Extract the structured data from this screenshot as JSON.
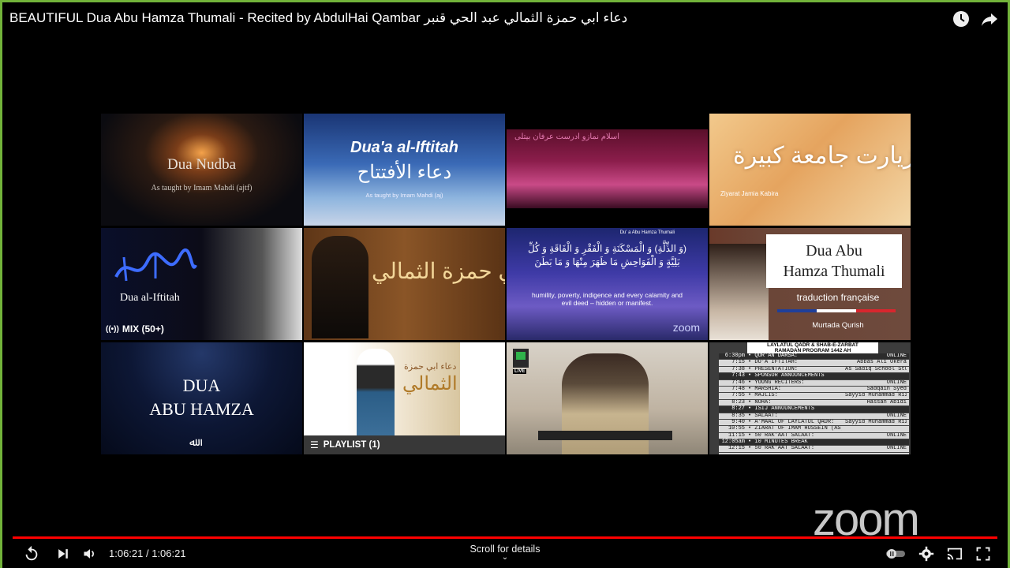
{
  "window": {
    "title": "BEAUTIFUL Dua Abu Hamza Thumali - Recited by AbdulHai Qambar دعاء ابي حمزة الثمالي عبد الحي قنبر"
  },
  "tiles": [
    {
      "title": "Dua Nudba",
      "subtitle": "As taught by Imam Mahdi (ajtf)"
    },
    {
      "title": "Dua'a al-Iftitah",
      "arabic": "دعاء الأفتتاح",
      "subtitle": "As taught by Imam Mahdi (aj)"
    },
    {
      "arabic": "اسلام نمازو ادرست عرفان بیتلی"
    },
    {
      "arabic": "زیارت جامعة کبیرة",
      "subtitle": "Ziyarat Jamia Kabira"
    },
    {
      "title": "Dua al-Iftitah",
      "badge": "MIX (50+)"
    },
    {
      "arabic": "دعاء أبي حمزة الثمالي"
    },
    {
      "header": "Du' a Abu Hamza Thumali",
      "arabic": "(وَ الذِّلَّةِ) وَ الْمَسْكَنَةِ وَ الْفَقْرِ وَ الْفَاقَةِ وَ كُلِّ بَلِيَّةٍ وَ الْفَوَاحِشِ مَا ظَهَرَ مِنْهَا وَ مَا بَطَنَ",
      "english": "humility, poverty, indigence and every calamity and evil deed – hidden or manifest.",
      "watermark": "zoom"
    },
    {
      "title_line1": "Dua Abu",
      "title_line2": "Hamza Thumali",
      "subtitle": "traduction française",
      "author": "Murtada Qurish"
    },
    {
      "title_line1": "DUA",
      "title_line2": "ABU HAMZA"
    },
    {
      "arabic_small": "دعاء ابي حمزة",
      "arabic_big": "الثمالي",
      "badge": "PLAYLIST (1)"
    },
    {
      "badge": "LIVE"
    },
    {
      "header1": "LAYLATUL QADR & SHAB-E-ZARBAT",
      "header2": "RAMADAN PROGRAM 1442 AH",
      "rows": [
        {
          "time": "6:30pm",
          "item": "• QUR'AN DARSA:",
          "who": "ONLINE",
          "dark": true
        },
        {
          "time": "7:15",
          "item": "• DU'A IFTITAH:",
          "who": "Abbas Ali Okera",
          "dark": false
        },
        {
          "time": "7:38",
          "item": "• PRESENTATION:",
          "who": "As Sadiq School Students",
          "dark": false
        },
        {
          "time": "7:43",
          "item": "• SPONSOR ANNOUNCEMENTS",
          "who": "",
          "dark": true
        },
        {
          "time": "7:46",
          "item": "• YOUNG RECITERS:",
          "who": "ONLINE",
          "dark": false
        },
        {
          "time": "7:48",
          "item": "• MARSHIA:",
          "who": "Sadqain Syed",
          "dark": false
        },
        {
          "time": "7:55",
          "item": "• MAJLIS:",
          "who": "Sayyid Muhammad Rizvi",
          "dark": false
        },
        {
          "time": "8:23",
          "item": "• NOHA:",
          "who": "Hassan Abidi",
          "dark": false
        },
        {
          "time": "8:27",
          "item": "• ISIJ ANNOUNCEMENTS",
          "who": "",
          "dark": true
        },
        {
          "time": "8:35",
          "item": "• SALAAT:",
          "who": "ONLINE",
          "dark": false
        },
        {
          "time": "9:40",
          "item": "• A'MAAL OF LAYLATUL QADR:",
          "who": "Sayyid Muhammad Rizvi",
          "dark": false
        },
        {
          "time": "10:55",
          "item": "• ZIARAT OF IMAM HUSSEIN (AS) ON THE NIGHT OF QADR",
          "who": "",
          "dark": false
        },
        {
          "time": "11:15",
          "item": "• 50 RAK'AAT SALAAT:",
          "who": "ONLINE",
          "dark": false
        },
        {
          "time": "12:05am",
          "item": "• 10 MINUTES BREAK",
          "who": "",
          "dark": true
        },
        {
          "time": "12:15",
          "item": "• 50 RAK'AAT SALAAT:",
          "who": "ONLINE",
          "dark": false
        }
      ]
    }
  ],
  "watermark": {
    "text": "zoom"
  },
  "player": {
    "time_current": "1:06:21",
    "time_separator": " / ",
    "time_total": "1:06:21",
    "time_display": "1:06:21 / 1:06:21",
    "scroll_hint": "Scroll for details",
    "progress_fraction": 1.0
  },
  "colors": {
    "progress": "#ff0000",
    "frame": "#72b33a"
  }
}
